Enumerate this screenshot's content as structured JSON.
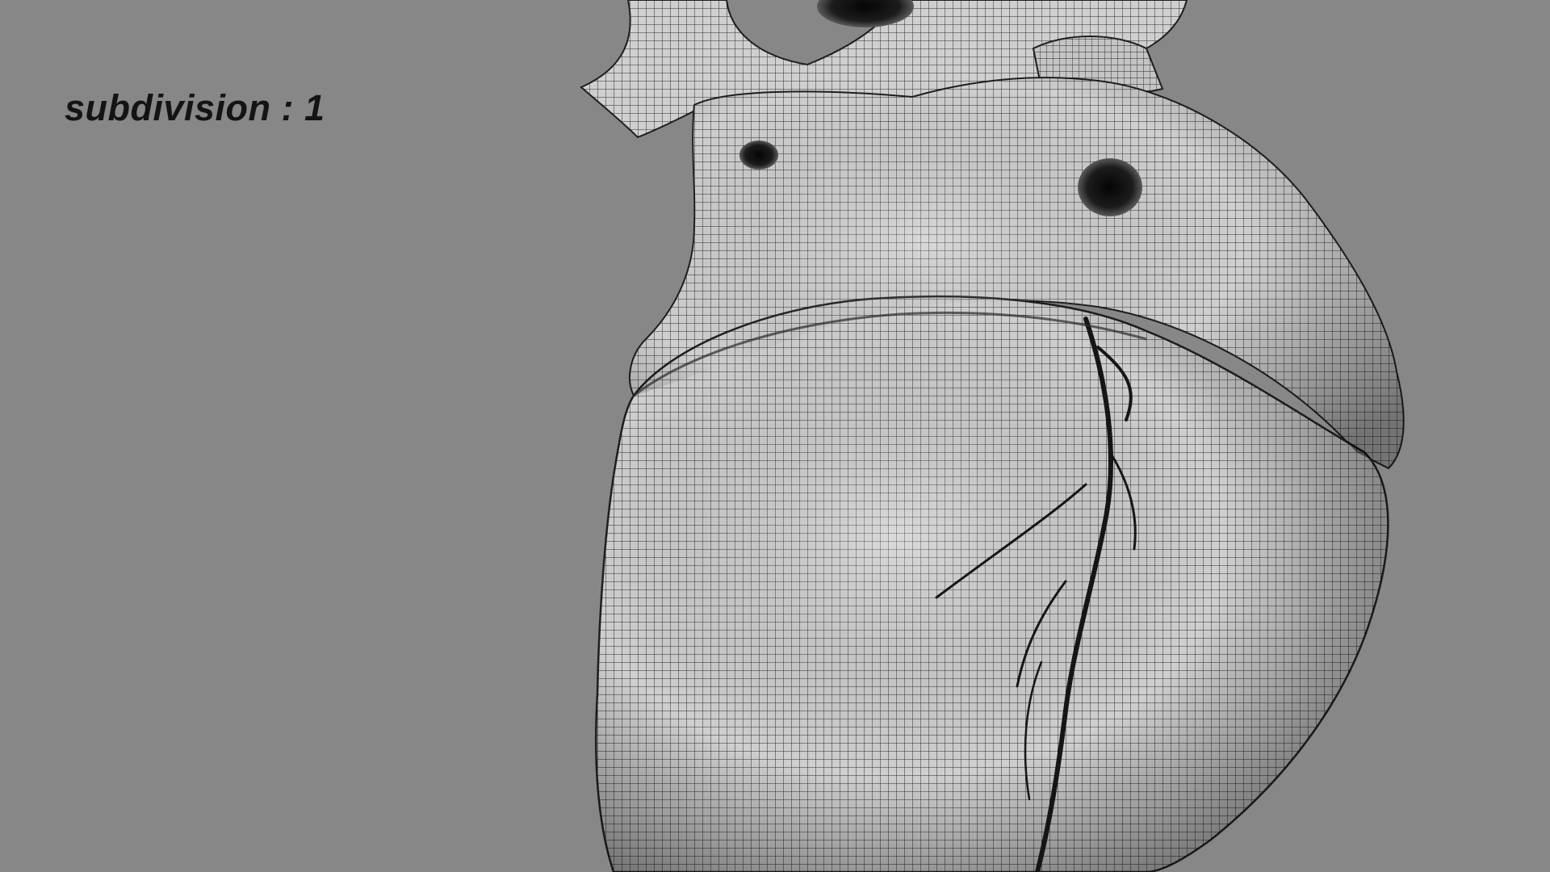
{
  "viewport": {
    "background_color": "#878787",
    "overlay_label": "subdivision : 1",
    "subject": {
      "icon": "heart-wireframe-mesh",
      "surface_color": "#c9c9c9",
      "wire_color": "#2a2a2a"
    }
  }
}
